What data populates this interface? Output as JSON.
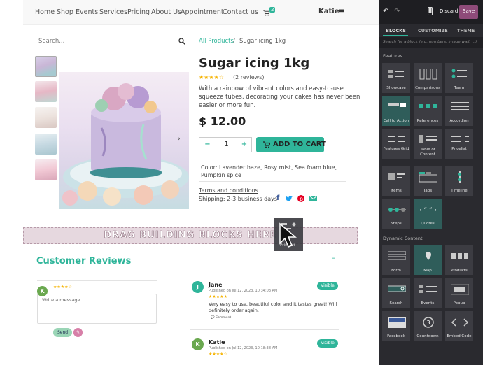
{
  "nav": {
    "links": [
      "Home",
      "Shop",
      "Events",
      "Services",
      "Pricing",
      "About Us",
      "Appointment",
      "Contact us"
    ],
    "cart_count": "2",
    "user": "Katie"
  },
  "search": {
    "placeholder": "Search..."
  },
  "breadcrumb": {
    "root": "All Products",
    "sep": "/",
    "current": "Sugar icing 1kg"
  },
  "product": {
    "title": "Sugar icing 1kg",
    "rating": 4.5,
    "reviews": "(2 reviews)",
    "description": [
      "With a rainbow of vibrant colors and easy-to-use",
      "squeeze tubes, decorating your cakes has never been",
      "easier or more fun."
    ],
    "price": "$ 12.00",
    "qty": "1",
    "add_to_cart": "ADD TO CART",
    "color_line1": "Color: Lavender haze, Rosy mist, Sea foam blue,",
    "color_line2": "Pumpkin spice",
    "terms": "Terms and conditions",
    "shipping": "Shipping: 2-3 business days"
  },
  "dropzone": "DRAG BUILDING BLOCKS HERE",
  "drag_label": "Pricelist",
  "reviews_section": {
    "title": "Customer Reviews",
    "collapse_icon": "–",
    "comment": {
      "avatar": "K",
      "placeholder": "Write a message...",
      "send": "Send"
    },
    "items": [
      {
        "avatar": "J",
        "name": "Jane",
        "date": "Published on Jul 12, 2023, 10:34:03 AM",
        "badge": "Visible",
        "text1": "Very easy to use, beautiful color and it tastes great! Will",
        "text2": "definitely order again.",
        "comment": "Comment"
      },
      {
        "avatar": "K",
        "name": "Katie",
        "date": "Published on Jul 12, 2023, 10:18:38 AM",
        "badge": "Visible"
      }
    ]
  },
  "editor": {
    "discard": "Discard",
    "save": "Save",
    "tabs": [
      "BLOCKS",
      "CUSTOMIZE",
      "THEME"
    ],
    "search_placeholder": "Search for a block (e.g. numbers, image wall, ...)",
    "section_features": "Features",
    "features": [
      "Showcase",
      "Comparisons",
      "Team",
      "Call to Action",
      "References",
      "Accordion",
      "Features Grid",
      "Table of Content",
      "Pricelist",
      "Items",
      "Tabs",
      "Timeline",
      "Steps",
      "Quotes"
    ],
    "section_dynamic": "Dynamic Content",
    "dynamic": [
      "Form",
      "Map",
      "Products",
      "Search",
      "Events",
      "Popup",
      "Facebook",
      "Countdown",
      "Embed Code"
    ],
    "accent": "#2fb59a",
    "save_color": "#8e4b79"
  }
}
